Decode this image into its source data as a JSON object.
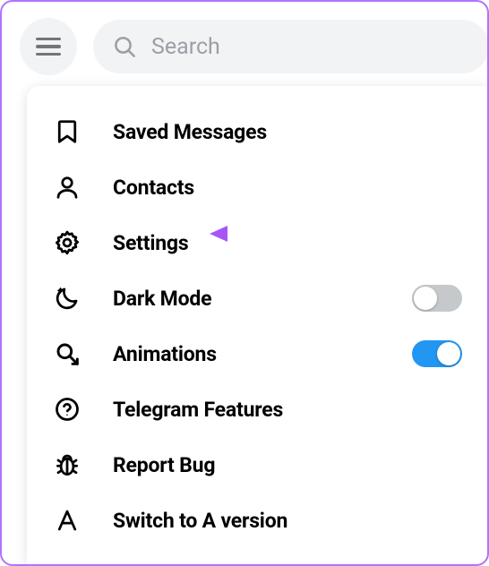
{
  "search": {
    "placeholder": "Search"
  },
  "menu": {
    "items": [
      {
        "label": "Saved Messages"
      },
      {
        "label": "Contacts"
      },
      {
        "label": "Settings"
      },
      {
        "label": "Dark Mode",
        "toggle": false
      },
      {
        "label": "Animations",
        "toggle": true
      },
      {
        "label": "Telegram Features"
      },
      {
        "label": "Report Bug"
      },
      {
        "label": "Switch to A version"
      }
    ]
  },
  "callout": {
    "color": "#a855f7"
  }
}
